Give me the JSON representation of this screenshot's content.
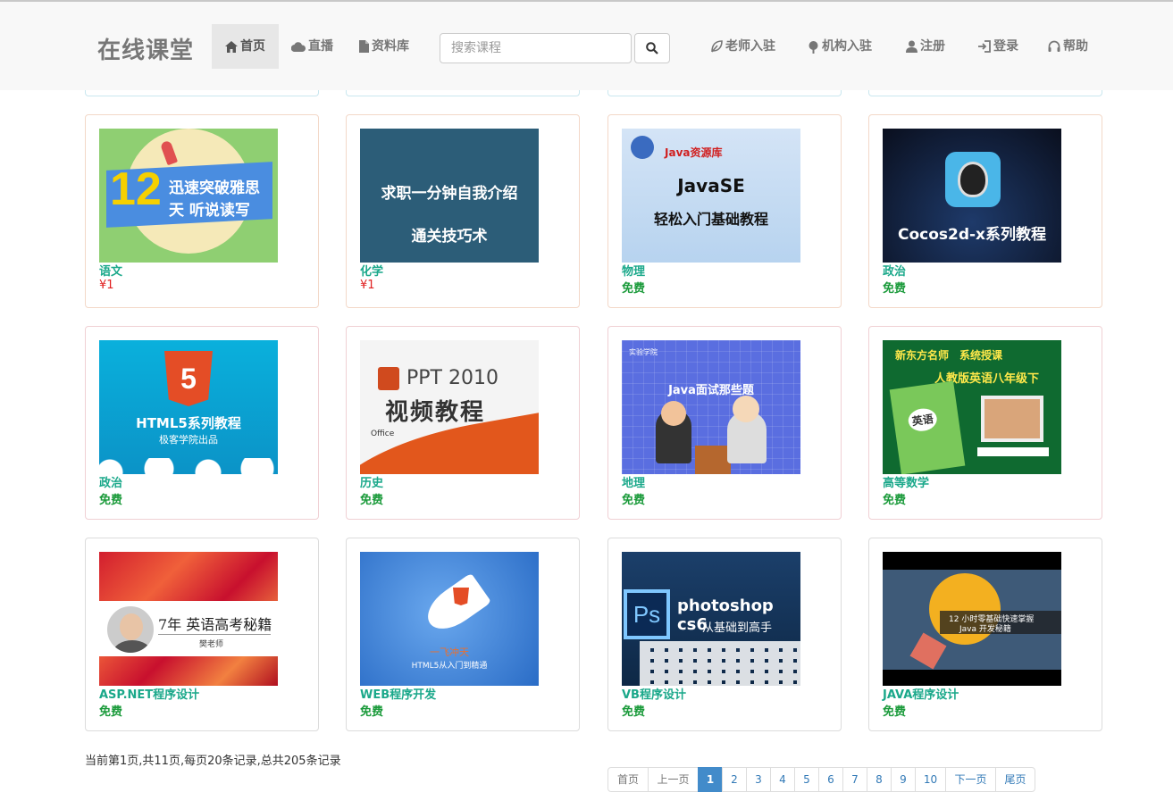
{
  "header": {
    "brand": "在线课堂",
    "nav": [
      {
        "label": "首页",
        "icon": "home-icon",
        "active": true
      },
      {
        "label": "直播",
        "icon": "cloud-icon",
        "active": false
      },
      {
        "label": "资料库",
        "icon": "file-icon",
        "active": false
      }
    ],
    "search": {
      "placeholder": "搜索课程",
      "value": ""
    },
    "right_nav": [
      {
        "label": "老师入驻",
        "icon": "leaf-icon"
      },
      {
        "label": "机构入驻",
        "icon": "tree-icon"
      },
      {
        "label": "注册",
        "icon": "user-icon"
      },
      {
        "label": "登录",
        "icon": "login-icon"
      },
      {
        "label": "帮助",
        "icon": "headphones-icon"
      }
    ]
  },
  "courses": [
    {
      "title": "语文",
      "price": "¥1",
      "paid": true,
      "cover": {
        "lines": [
          "12",
          "迅速突破雅思",
          "天 听说读写"
        ]
      }
    },
    {
      "title": "化学",
      "price": "¥1",
      "paid": true,
      "cover": {
        "lines": [
          "求职一分钟自我介绍",
          "通关技巧术"
        ]
      }
    },
    {
      "title": "物理",
      "price": "免费",
      "paid": false,
      "cover": {
        "lines": [
          "Java资源库",
          "JavaSE",
          "轻松入门基础教程"
        ]
      }
    },
    {
      "title": "政治",
      "price": "免费",
      "paid": false,
      "cover": {
        "lines": [
          "Cocos2d-x系列教程"
        ]
      }
    },
    {
      "title": "政治",
      "price": "免费",
      "paid": false,
      "cover": {
        "lines": [
          "5",
          "HTML5系列教程",
          "极客学院出品"
        ]
      }
    },
    {
      "title": "历史",
      "price": "免费",
      "paid": false,
      "cover": {
        "lines": [
          "PPT 2010",
          "视频教程",
          "Office"
        ]
      }
    },
    {
      "title": "地理",
      "price": "免费",
      "paid": false,
      "cover": {
        "lines": [
          "实验学院",
          "Java面试那些题"
        ]
      }
    },
    {
      "title": "高等数学",
      "price": "免费",
      "paid": false,
      "cover": {
        "lines": [
          "新东方名师　系统授课",
          "人教版英语八年级下",
          "英语"
        ]
      }
    },
    {
      "title": "ASP.NET程序设计",
      "price": "免费",
      "paid": false,
      "cover": {
        "lines": [
          "7年 英语高考秘籍",
          "樊老师"
        ]
      }
    },
    {
      "title": "WEB程序开发",
      "price": "免费",
      "paid": false,
      "cover": {
        "lines": [
          "一飞冲天",
          "HTML5从入门到精通"
        ]
      }
    },
    {
      "title": "VB程序设计",
      "price": "免费",
      "paid": false,
      "cover": {
        "lines": [
          "Ps",
          "photoshop cs6",
          "从基础到高手"
        ]
      }
    },
    {
      "title": "JAVA程序设计",
      "price": "免费",
      "paid": false,
      "cover": {
        "lines": [
          "12 小时零基础快速掌握",
          "Java 开发秘籍"
        ]
      }
    }
  ],
  "record_info": "当前第1页,共11页,每页20条记录,总共205条记录",
  "pagination": {
    "first": "首页",
    "prev": "上一页",
    "pages": [
      "1",
      "2",
      "3",
      "4",
      "5",
      "6",
      "7",
      "8",
      "9",
      "10"
    ],
    "current": "1",
    "next": "下一页",
    "last": "尾页"
  }
}
